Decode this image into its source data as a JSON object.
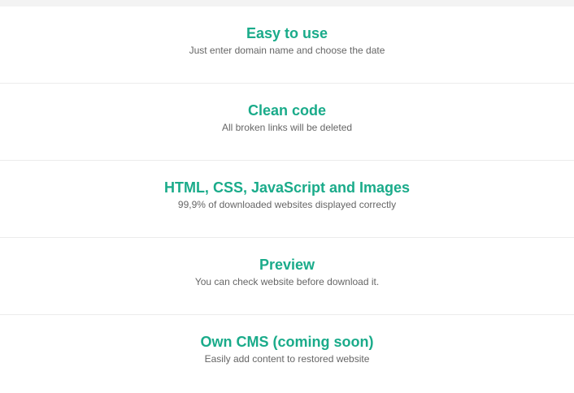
{
  "colors": {
    "accent": "#1aab8a",
    "description": "#666666",
    "divider": "#ececec",
    "top_strip": "#f3f3f3"
  },
  "features": [
    {
      "title": "Easy to use",
      "description": "Just enter domain name and choose the date"
    },
    {
      "title": "Clean code",
      "description": "All broken links will be deleted"
    },
    {
      "title": "HTML, CSS, JavaScript and Images",
      "description": "99,9% of downloaded websites displayed correctly"
    },
    {
      "title": "Preview",
      "description": "You can check website before download it."
    },
    {
      "title": "Own CMS (coming soon)",
      "description": "Easily add content to restored website"
    }
  ]
}
